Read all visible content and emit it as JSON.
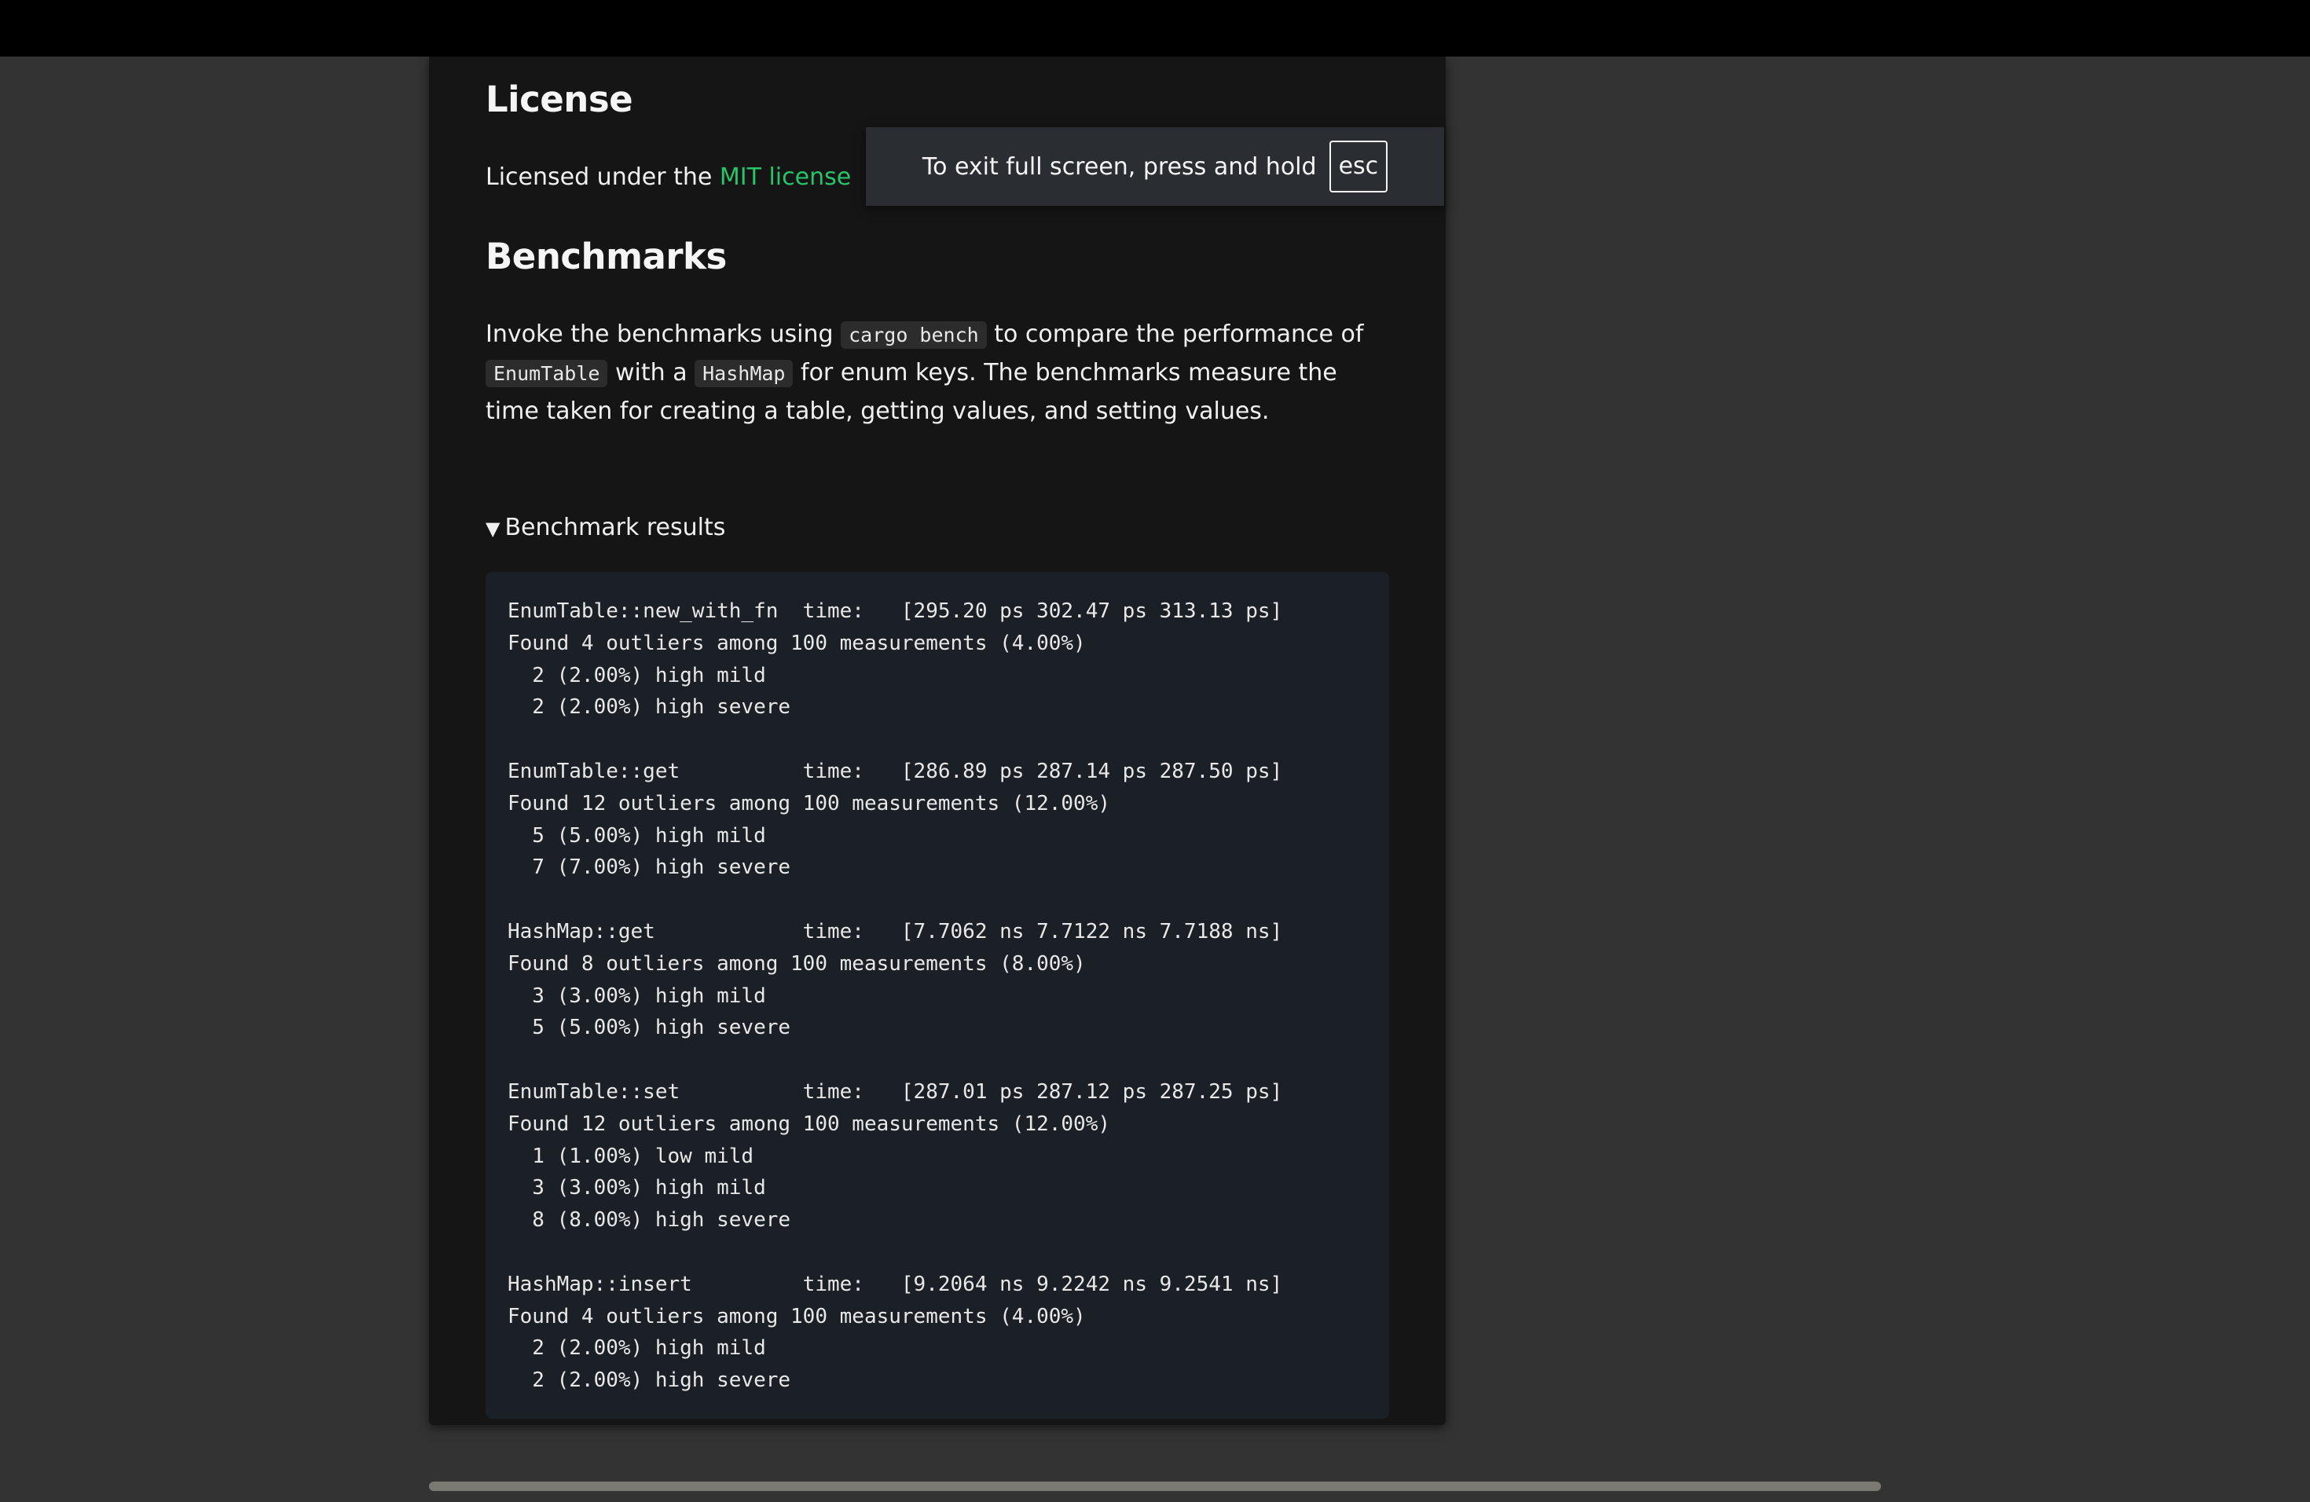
{
  "license": {
    "heading": "License",
    "text_prefix": "Licensed under the ",
    "link_label": "MIT license"
  },
  "benchmarks": {
    "heading": "Benchmarks",
    "desc_part1": "Invoke the benchmarks using ",
    "code_cargo": "cargo bench",
    "desc_part2": " to compare the performance of ",
    "code_enumtable": "EnumTable",
    "desc_part3": " with a ",
    "code_hashmap": "HashMap",
    "desc_part4": " for enum keys. The benchmarks measure the time taken for creating a table, getting values, and setting values.",
    "details_summary": "Benchmark results",
    "results_text": "EnumTable::new_with_fn  time:   [295.20 ps 302.47 ps 313.13 ps]\nFound 4 outliers among 100 measurements (4.00%)\n  2 (2.00%) high mild\n  2 (2.00%) high severe\n\nEnumTable::get          time:   [286.89 ps 287.14 ps 287.50 ps]\nFound 12 outliers among 100 measurements (12.00%)\n  5 (5.00%) high mild\n  7 (7.00%) high severe\n\nHashMap::get            time:   [7.7062 ns 7.7122 ns 7.7188 ns]\nFound 8 outliers among 100 measurements (8.00%)\n  3 (3.00%) high mild\n  5 (5.00%) high severe\n\nEnumTable::set          time:   [287.01 ps 287.12 ps 287.25 ps]\nFound 12 outliers among 100 measurements (12.00%)\n  1 (1.00%) low mild\n  3 (3.00%) high mild\n  8 (8.00%) high severe\n\nHashMap::insert         time:   [9.2064 ns 9.2242 ns 9.2541 ns]\nFound 4 outliers among 100 measurements (4.00%)\n  2 (2.00%) high mild\n  2 (2.00%) high severe"
  },
  "fullscreen_toast": {
    "message": "To exit full screen, press and hold",
    "key": "esc"
  },
  "colors": {
    "link": "#27c46a",
    "page_bg": "#333333",
    "article_bg": "#151515",
    "code_block_bg": "#1b1f26"
  }
}
